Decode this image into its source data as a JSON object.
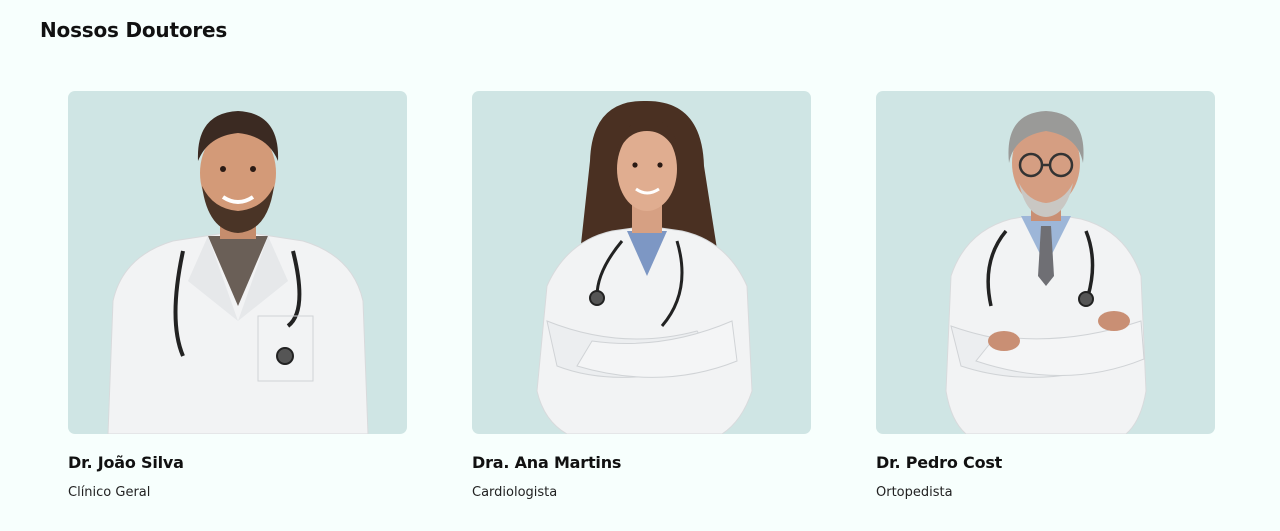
{
  "section": {
    "title": "Nossos Doutores"
  },
  "doctors": [
    {
      "name": "Dr. João Silva",
      "specialty": "Clínico Geral",
      "photo": "doctor-man-young-portrait"
    },
    {
      "name": "Dra. Ana Martins",
      "specialty": "Cardiologista",
      "photo": "doctor-woman-portrait"
    },
    {
      "name": "Dr. Pedro Cost",
      "specialty": "Ortopedista",
      "photo": "doctor-man-senior-portrait"
    }
  ],
  "colors": {
    "page_bg": "#f7fffd",
    "photo_bg": "#cfe5e4",
    "coat": "#f2f3f4"
  }
}
